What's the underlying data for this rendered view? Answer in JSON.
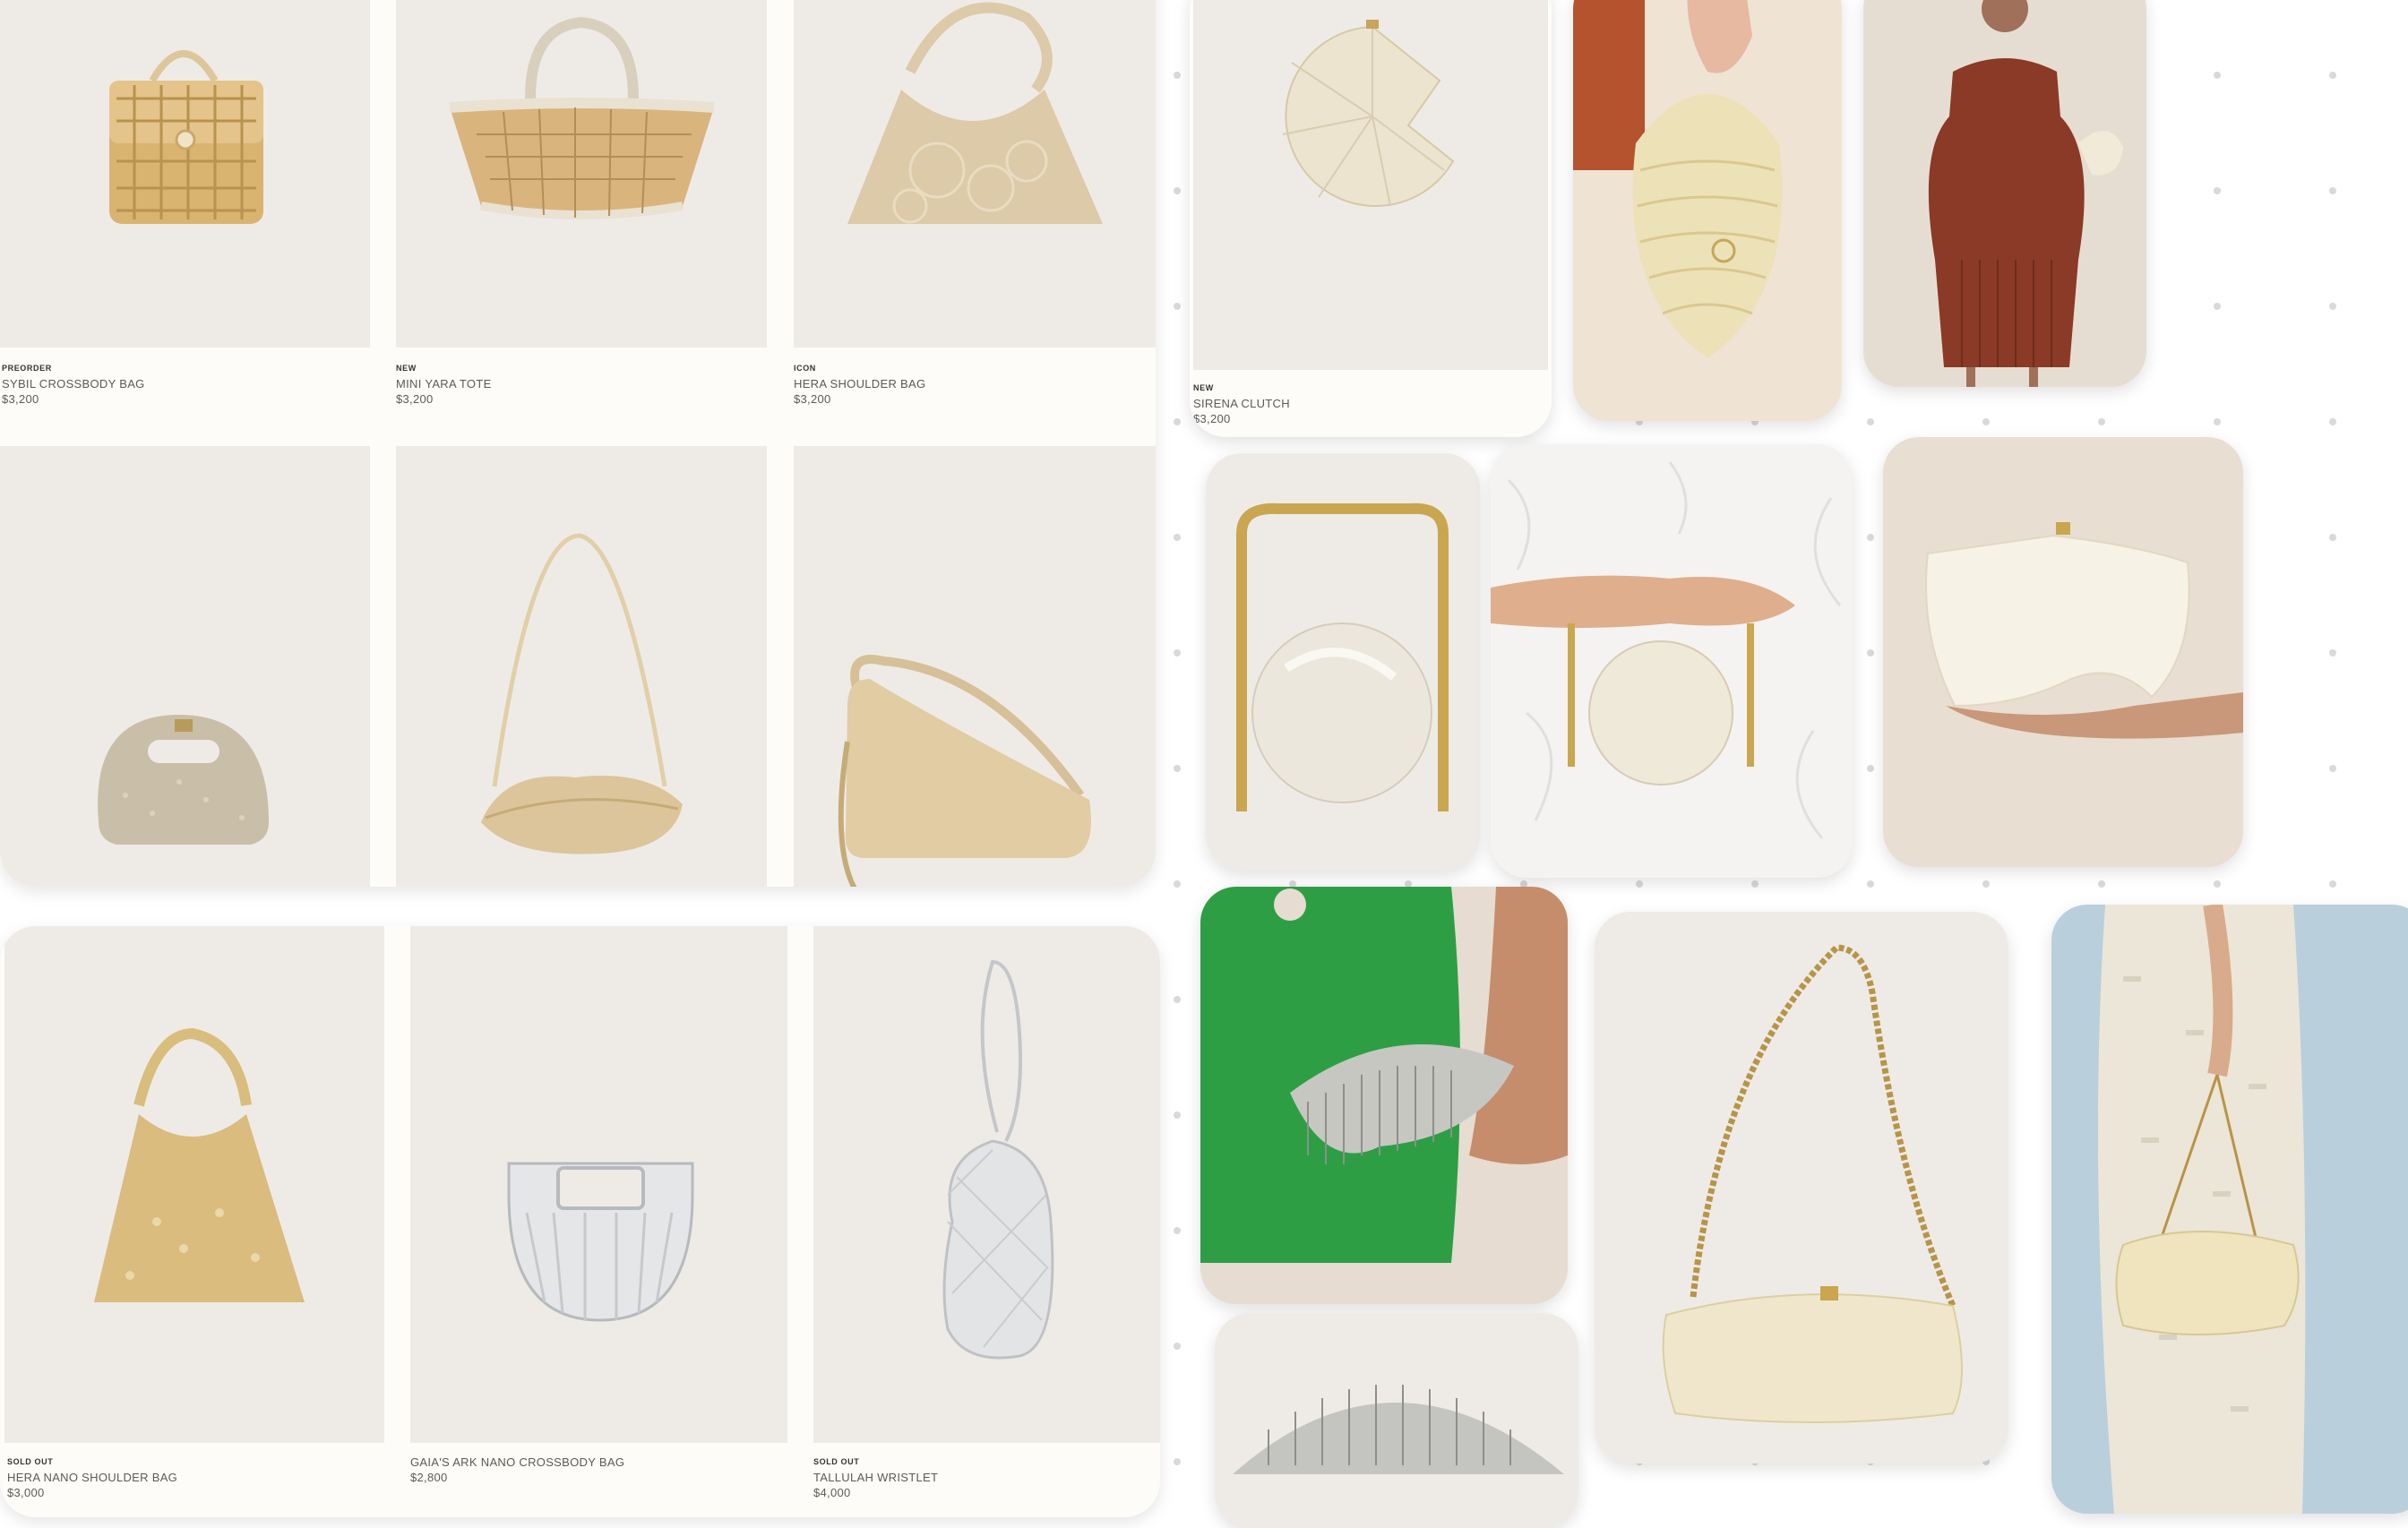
{
  "board_top": {
    "products": [
      {
        "badge": "PREORDER",
        "name": "SYBIL CROSSBODY BAG",
        "price": "$3,200"
      },
      {
        "badge": "NEW",
        "name": "MINI YARA TOTE",
        "price": "$3,200"
      },
      {
        "badge": "ICON",
        "name": "HERA SHOULDER BAG",
        "price": "$3,200"
      },
      {
        "badge": "",
        "name": "",
        "price": ""
      },
      {
        "badge": "",
        "name": "",
        "price": ""
      },
      {
        "badge": "",
        "name": "",
        "price": ""
      }
    ]
  },
  "board_bottom": {
    "products": [
      {
        "badge": "SOLD OUT",
        "name": "HERA NANO SHOULDER BAG",
        "price": "$3,000"
      },
      {
        "badge": "",
        "name": "GAIA'S ARK NANO CROSSBODY BAG",
        "price": "$2,800"
      },
      {
        "badge": "SOLD OUT",
        "name": "TALLULAH WRISTLET",
        "price": "$4,000"
      }
    ]
  },
  "cards": {
    "sirena": {
      "badge": "NEW",
      "name": "SIRENA CLUTCH",
      "price": "$3,200"
    }
  },
  "colors": {
    "photo_bg": "#eeebe7",
    "board_bg": "#fdfcf8",
    "canvas_dot": "#d9d9d9",
    "green_dress": "#2e9e45",
    "rust_dress": "#8a3a26"
  }
}
